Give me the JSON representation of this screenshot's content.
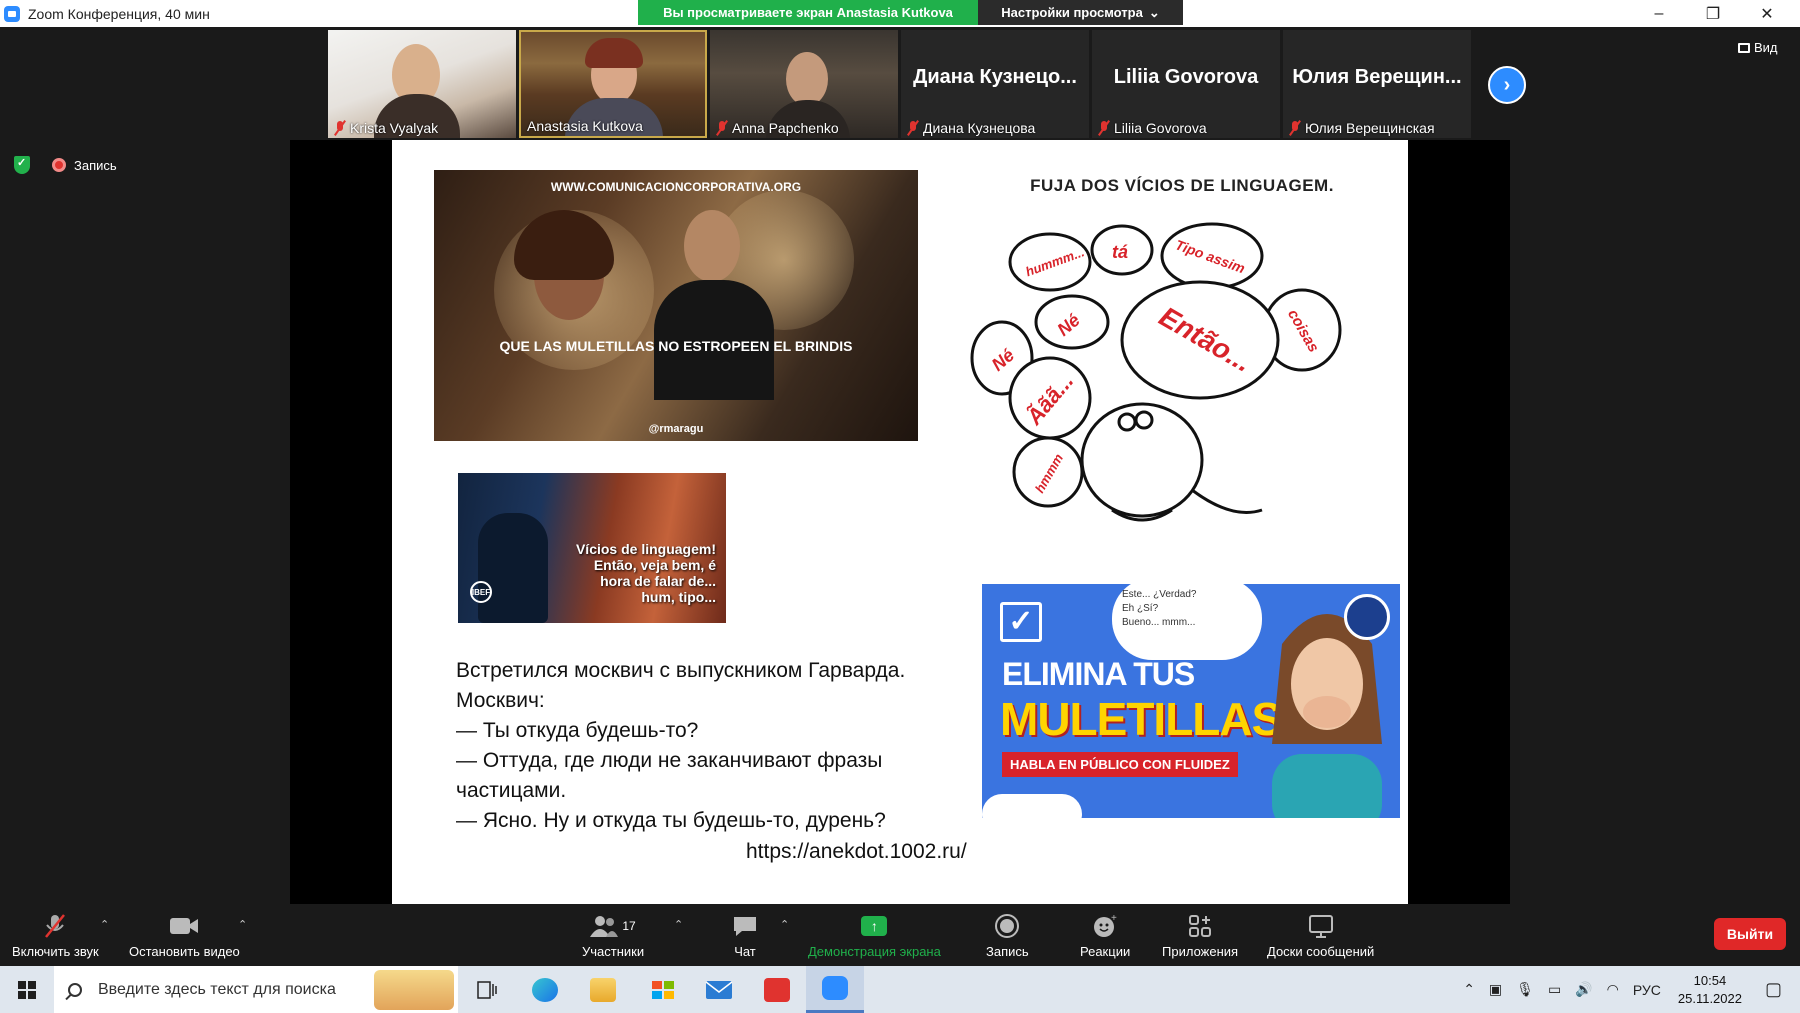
{
  "window": {
    "title": "Zoom Конференция, 40 мин",
    "share_banner": "Вы просматриваете экран Anastasia Kutkova",
    "view_settings": "Настройки просмотра",
    "minimize": "–",
    "restore": "❐",
    "close": "✕"
  },
  "participants": [
    {
      "name": "Krista Vyalyak",
      "type": "video"
    },
    {
      "name": "Anastasia Kutkova",
      "type": "video"
    },
    {
      "name": "Anna Papchenko",
      "type": "video"
    },
    {
      "name": "Диана Кузнецова",
      "display": "Диана  Кузнецо...",
      "type": "name"
    },
    {
      "name": "Liliia Govorova",
      "display": "Liliia Govorova",
      "type": "name"
    },
    {
      "name": "Юлия Верещинская",
      "display": "Юлия  Верещин...",
      "type": "name"
    }
  ],
  "view_button": "Вид",
  "recording_label": "Запись",
  "slide": {
    "dinner_url": "WWW.COMUNICACIONCORPORATIVA.ORG",
    "dinner_caption": "QUE LAS MULETILLAS NO ESTROPEEN EL BRINDIS",
    "dinner_credit": "@rmaragu",
    "speaker_text": [
      "Vícios de linguagem!",
      "Então, veja bem, é",
      "hora de falar de...",
      "hum, tipo..."
    ],
    "speaker_logo": "IBEF",
    "fuja_title": "FUJA DOS VÍCIOS DE LINGUAGEM.",
    "bubble_words": [
      "hummm...",
      "tá",
      "Tipo assim",
      "Né",
      "Né",
      "Então...",
      "coisas",
      "Ããã...",
      "hmmm"
    ],
    "joke_lines": [
      "Встретился москвич с выпускником Гарварда.",
      "Москвич:",
      "— Ты откуда будешь-то?",
      "— Оттуда, где люди не заканчивают фразы",
      "частицами.",
      "— Ясно. Ну и откуда ты будешь-то, дурень?"
    ],
    "joke_link": "https://anekdot.1002.ru/",
    "banner": {
      "line1": "ELIMINA TUS",
      "line2": "MULETILLAS",
      "line3": "HABLA EN PÚBLICO CON FLUIDEZ",
      "cloud_text": [
        "Este...      ¿Verdad?",
        "Eh     ¿Sí?",
        "Bueno...     mmm..."
      ]
    }
  },
  "toolbar": {
    "unmute": "Включить звук",
    "stop_video": "Остановить видео",
    "participants": "Участники",
    "participants_count": "17",
    "chat": "Чат",
    "share_screen": "Демонстрация экрана",
    "record": "Запись",
    "reactions": "Реакции",
    "apps": "Приложения",
    "whiteboards": "Доски сообщений",
    "leave": "Выйти"
  },
  "taskbar": {
    "search_placeholder": "Введите здесь текст для поиска",
    "language": "РУС",
    "time": "10:54",
    "date": "25.11.2022"
  },
  "colors": {
    "zoom_blue": "#2d8cff",
    "share_green": "#20b04b",
    "leave_red": "#e02828",
    "muted_red": "#e0332f"
  }
}
